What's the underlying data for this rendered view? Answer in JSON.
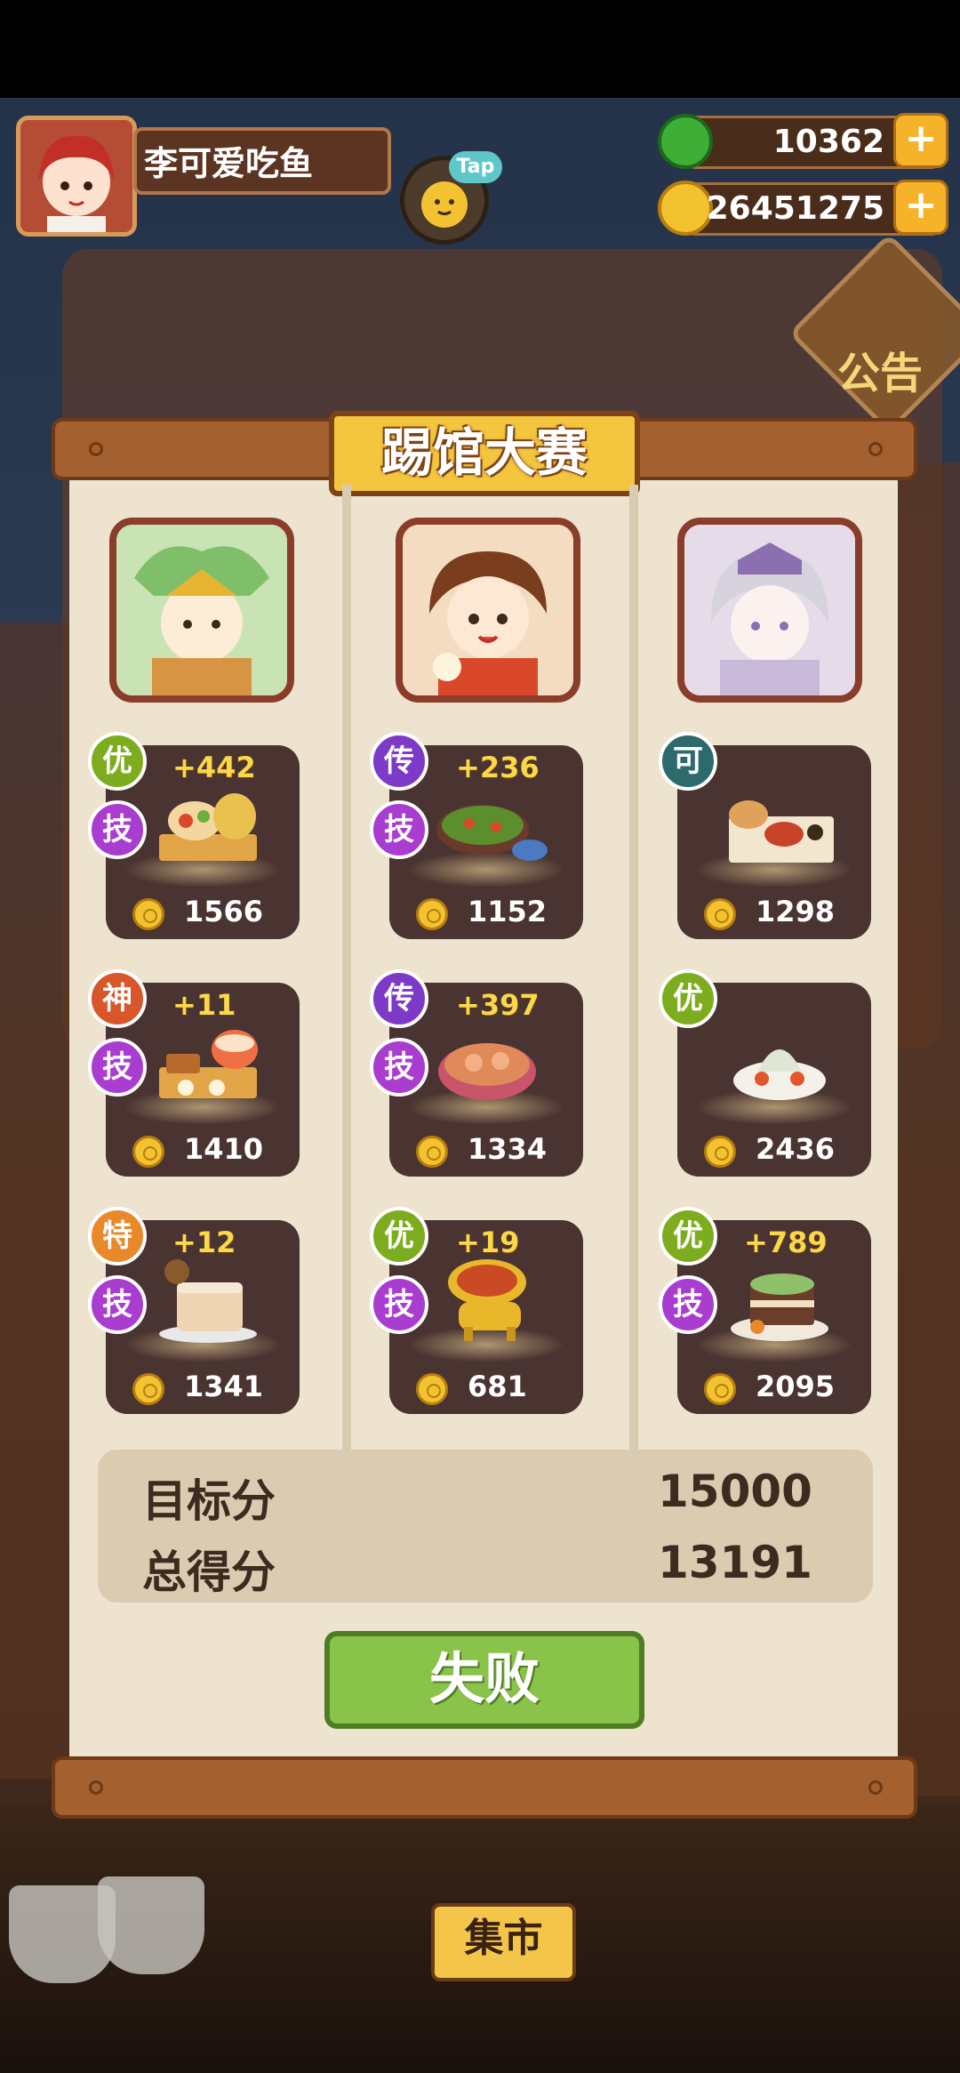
{
  "player": {
    "name": "李可爱吃鱼"
  },
  "hud": {
    "tap_label": "Tap",
    "jade": {
      "value": "10362",
      "plus": "+"
    },
    "coins": {
      "value": "26451275",
      "plus": "+"
    },
    "notice_label": "公告"
  },
  "modal": {
    "title": "踢馆大赛",
    "columns": [
      {
        "dishes": [
          {
            "grade": "优",
            "skill": "技",
            "bonus": "+442",
            "price": "1566"
          },
          {
            "grade": "神",
            "skill": "技",
            "bonus": "+11",
            "price": "1410"
          },
          {
            "grade": "特",
            "skill": "技",
            "bonus": "+12",
            "price": "1341"
          }
        ]
      },
      {
        "dishes": [
          {
            "grade": "传",
            "skill": "技",
            "bonus": "+236",
            "price": "1152"
          },
          {
            "grade": "传",
            "skill": "技",
            "bonus": "+397",
            "price": "1334"
          },
          {
            "grade": "优",
            "skill": "技",
            "bonus": "+19",
            "price": "681"
          }
        ]
      },
      {
        "dishes": [
          {
            "grade": "可",
            "skill": "",
            "bonus": "",
            "price": "1298"
          },
          {
            "grade": "优",
            "skill": "",
            "bonus": "",
            "price": "2436"
          },
          {
            "grade": "优",
            "skill": "技",
            "bonus": "+789",
            "price": "2095"
          }
        ]
      }
    ],
    "score": {
      "target_label": "目标分",
      "target_value": "15000",
      "total_label": "总得分",
      "total_value": "13191"
    },
    "result_button": "失败"
  },
  "background": {
    "market_sign": "集市"
  },
  "colors": {
    "grade_you": "#7dad1f",
    "grade_chuan": "#7d3ac7",
    "grade_ke": "#2c6a6c",
    "grade_shen": "#d8562a",
    "grade_te": "#e8892a",
    "skill": "#a93dd0",
    "fail_button": "#89c34a"
  }
}
